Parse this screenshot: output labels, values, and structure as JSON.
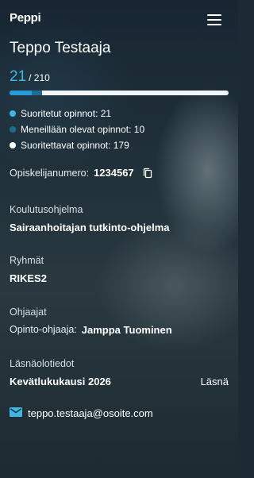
{
  "app": {
    "logo": "Peppi"
  },
  "profile": {
    "name": "Teppo Testaaja"
  },
  "credits": {
    "completed": "21",
    "total": "/ 210",
    "completed_fraction": 0.1,
    "in_progress_fraction": 0.0476
  },
  "legend": [
    {
      "label": "Suoritetut opinnot: 21",
      "color": "#41b6e6"
    },
    {
      "label": "Meneillään olevat opinnot: 10",
      "color": "#1f6c90"
    },
    {
      "label": "Suoritettavat opinnot: 179",
      "color": "#ffffff"
    }
  ],
  "student": {
    "label": "Opiskelijanumero:",
    "number": "1234567"
  },
  "program": {
    "label": "Koulutusohjelma",
    "value": "Sairaanhoitajan tutkinto-ohjelma"
  },
  "groups": {
    "label": "Ryhmät",
    "value": "RIKES2"
  },
  "advisors": {
    "label": "Ohjaajat",
    "role": "Opinto-ohjaaja:",
    "name": "Jamppa Tuominen"
  },
  "attendance": {
    "label": "Läsnäolotiedot",
    "term": "Kevätlukukausi 2026",
    "status": "Läsnä"
  },
  "contact": {
    "email": "teppo.testaaja@osoite.com"
  },
  "icons": {
    "menu": "hamburger-menu-icon",
    "copy": "copy-icon",
    "email": "email-icon"
  }
}
